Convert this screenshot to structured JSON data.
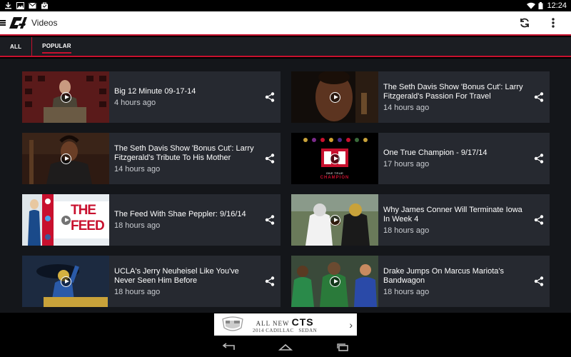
{
  "status_bar": {
    "time": "12:24"
  },
  "app_bar": {
    "title": "Videos"
  },
  "tabs": [
    {
      "label": "ALL",
      "active": false
    },
    {
      "label": "POPULAR",
      "active": true
    }
  ],
  "videos": [
    {
      "title": "Big 12 Minute 09-17-14",
      "time": "4 hours ago",
      "thumb": "podium-speaker"
    },
    {
      "title": "The Seth Davis Show 'Bonus Cut': Larry Fitzgerald's Passion For Travel",
      "time": "14 hours ago",
      "thumb": "closeup-face"
    },
    {
      "title": "The Seth Davis Show 'Bonus Cut': Larry Fitzgerald's Tribute To His Mother",
      "time": "14 hours ago",
      "thumb": "interview"
    },
    {
      "title": "One True Champion - 9/17/14",
      "time": "17 hours ago",
      "thumb": "big12-logo"
    },
    {
      "title": "The Feed With Shae Peppler: 9/16/14",
      "time": "18 hours ago",
      "thumb": "the-feed"
    },
    {
      "title": "Why James Conner Will Terminate Iowa In Week 4",
      "time": "18 hours ago",
      "thumb": "football-players"
    },
    {
      "title": "UCLA's Jerry Neuheisel Like You've Never Seen Him Before",
      "time": "18 hours ago",
      "thumb": "ucla-player"
    },
    {
      "title": "Drake Jumps On Marcus Mariota's Bandwagon",
      "time": "18 hours ago",
      "thumb": "soccer-players"
    }
  ],
  "ad": {
    "line1": "ALL NEW",
    "brand": "CTS",
    "line2": "2014 CADILLAC",
    "line3": "SEDAN",
    "arrow": "›"
  },
  "thumb_text": {
    "feed": "THE FEED",
    "one_true": "ONE TRUE",
    "champion": "CHAMPION"
  }
}
